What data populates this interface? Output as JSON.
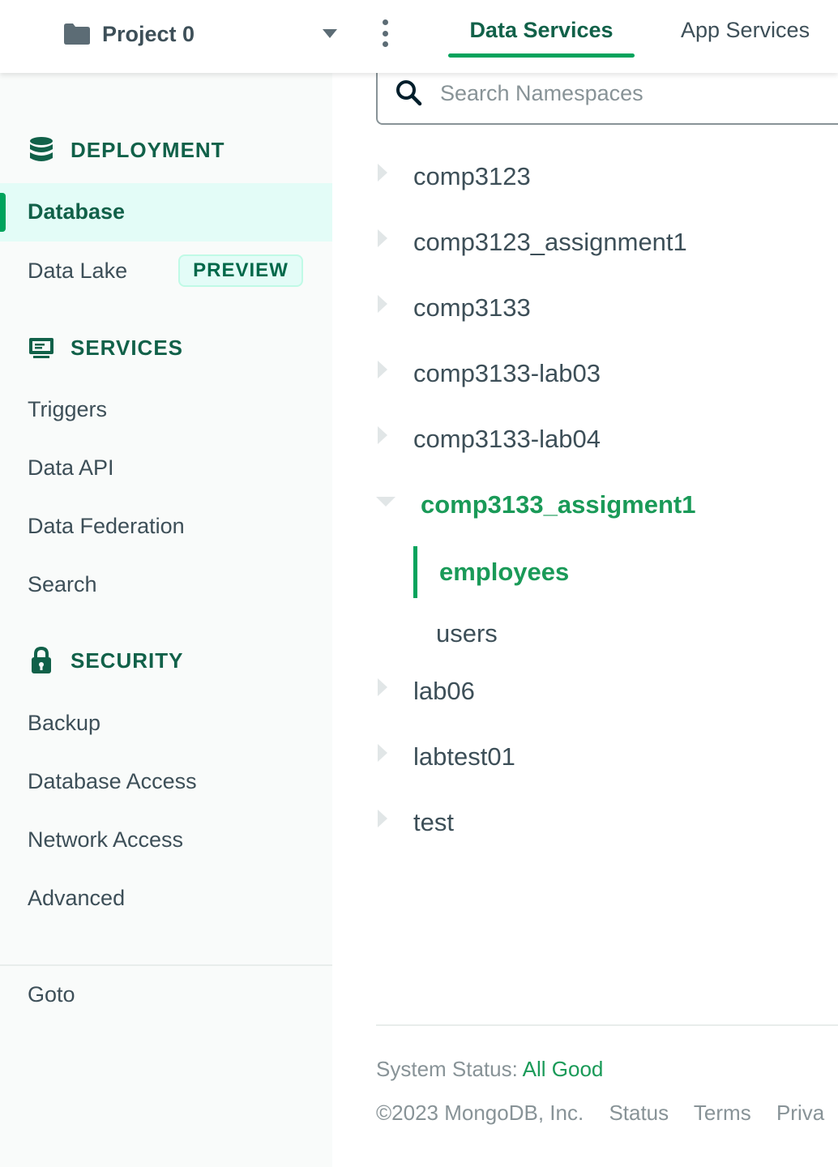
{
  "header": {
    "project_name": "Project 0",
    "tabs": [
      {
        "label": "Data Services",
        "active": true
      },
      {
        "label": "App Services",
        "active": false
      }
    ]
  },
  "sidebar": {
    "deployment": {
      "heading": "DEPLOYMENT",
      "icon": "database-icon",
      "items": [
        {
          "label": "Database",
          "active": true
        },
        {
          "label": "Data Lake",
          "badge": "PREVIEW"
        }
      ]
    },
    "services": {
      "heading": "SERVICES",
      "icon": "monitor-icon",
      "items": [
        {
          "label": "Triggers"
        },
        {
          "label": "Data API"
        },
        {
          "label": "Data Federation"
        },
        {
          "label": "Search"
        }
      ]
    },
    "security": {
      "heading": "SECURITY",
      "icon": "lock-icon",
      "items": [
        {
          "label": "Backup"
        },
        {
          "label": "Database Access"
        },
        {
          "label": "Network Access"
        },
        {
          "label": "Advanced"
        }
      ]
    },
    "goto": "Goto"
  },
  "search": {
    "placeholder": "Search Namespaces",
    "value": ""
  },
  "namespaces": [
    {
      "name": "comp3123"
    },
    {
      "name": "comp3123_assignment1"
    },
    {
      "name": "comp3133"
    },
    {
      "name": "comp3133-lab03"
    },
    {
      "name": "comp3133-lab04"
    },
    {
      "name": "comp3133_assigment1",
      "expanded": true,
      "collections": [
        {
          "name": "employees",
          "selected": true
        },
        {
          "name": "users"
        }
      ]
    },
    {
      "name": "lab06"
    },
    {
      "name": "labtest01"
    },
    {
      "name": "test"
    }
  ],
  "footer": {
    "status_label": "System Status:",
    "status_value": "All Good",
    "copyright": "©2023 MongoDB, Inc.",
    "links": [
      "Status",
      "Terms",
      "Priva"
    ]
  },
  "colors": {
    "brand_green": "#00a35c",
    "dark_green": "#116149",
    "active_bg": "#e3fcf7"
  }
}
